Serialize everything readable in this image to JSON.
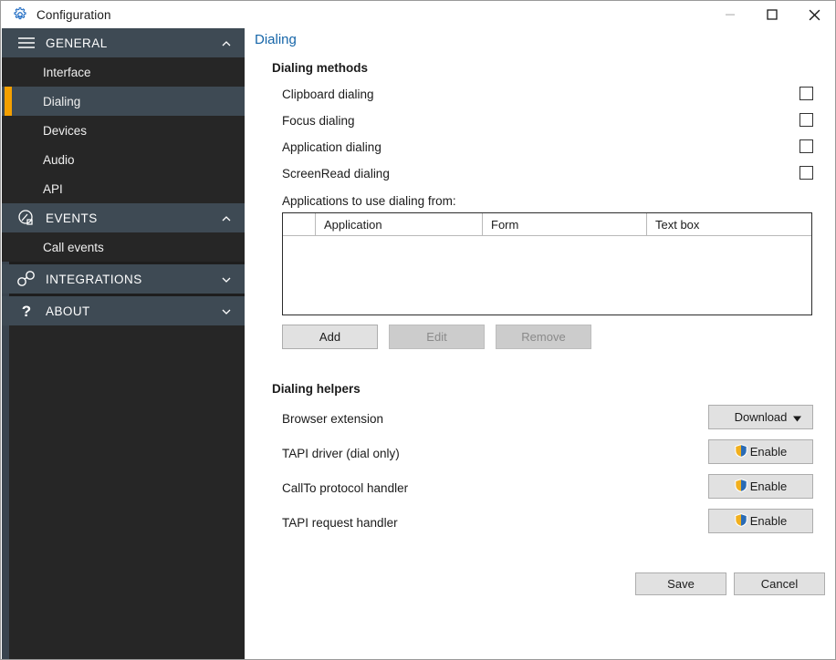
{
  "window": {
    "title": "Configuration",
    "icon": "gear-icon",
    "controls": {
      "minimize": "minimize-icon",
      "maximize": "maximize-icon",
      "close": "close-icon"
    }
  },
  "colors": {
    "accent_selected": "#f5a000",
    "sidebar_header": "#3e4a54",
    "sidebar_bg": "#262626",
    "page_title": "#1565a8",
    "shield_blue": "#2a6bb5",
    "shield_gold": "#f2b01e"
  },
  "sidebar": {
    "groups": [
      {
        "label": "GENERAL",
        "icon": "hamburger-icon",
        "expanded": true,
        "chevron": "chevron-up-icon",
        "items": [
          {
            "label": "Interface",
            "selected": false
          },
          {
            "label": "Dialing",
            "selected": true
          },
          {
            "label": "Devices",
            "selected": false
          },
          {
            "label": "Audio",
            "selected": false
          },
          {
            "label": "API",
            "selected": false
          }
        ]
      },
      {
        "label": "EVENTS",
        "icon": "call-bubble-icon",
        "expanded": true,
        "chevron": "chevron-up-icon",
        "items": [
          {
            "label": "Call events",
            "selected": false
          }
        ]
      },
      {
        "label": "INTEGRATIONS",
        "icon": "chain-link-icon",
        "expanded": false,
        "chevron": "chevron-down-icon",
        "items": []
      },
      {
        "label": "ABOUT",
        "icon": "question-mark-icon",
        "expanded": false,
        "chevron": "chevron-down-icon",
        "items": []
      }
    ]
  },
  "page": {
    "title": "Dialing",
    "methods": {
      "heading": "Dialing methods",
      "options": [
        {
          "label": "Clipboard dialing",
          "checked": false
        },
        {
          "label": "Focus dialing",
          "checked": false
        },
        {
          "label": "Application dialing",
          "checked": false
        },
        {
          "label": "ScreenRead dialing",
          "checked": false
        }
      ],
      "apps_label": "Applications to use dialing from:",
      "table": {
        "columns": [
          "",
          "Application",
          "Form",
          "Text box"
        ],
        "rows": []
      },
      "buttons": [
        {
          "label": "Add",
          "enabled": true
        },
        {
          "label": "Edit",
          "enabled": false
        },
        {
          "label": "Remove",
          "enabled": false
        }
      ]
    },
    "helpers": {
      "heading": "Dialing helpers",
      "rows": [
        {
          "label": "Browser extension",
          "action": "Download",
          "type": "dropdown",
          "shield": false
        },
        {
          "label": "TAPI driver (dial only)",
          "action": "Enable",
          "type": "button",
          "shield": true
        },
        {
          "label": "CallTo protocol handler",
          "action": "Enable",
          "type": "button",
          "shield": true
        },
        {
          "label": "TAPI request handler",
          "action": "Enable",
          "type": "button",
          "shield": true
        }
      ]
    },
    "footer": {
      "save": "Save",
      "cancel": "Cancel"
    }
  }
}
